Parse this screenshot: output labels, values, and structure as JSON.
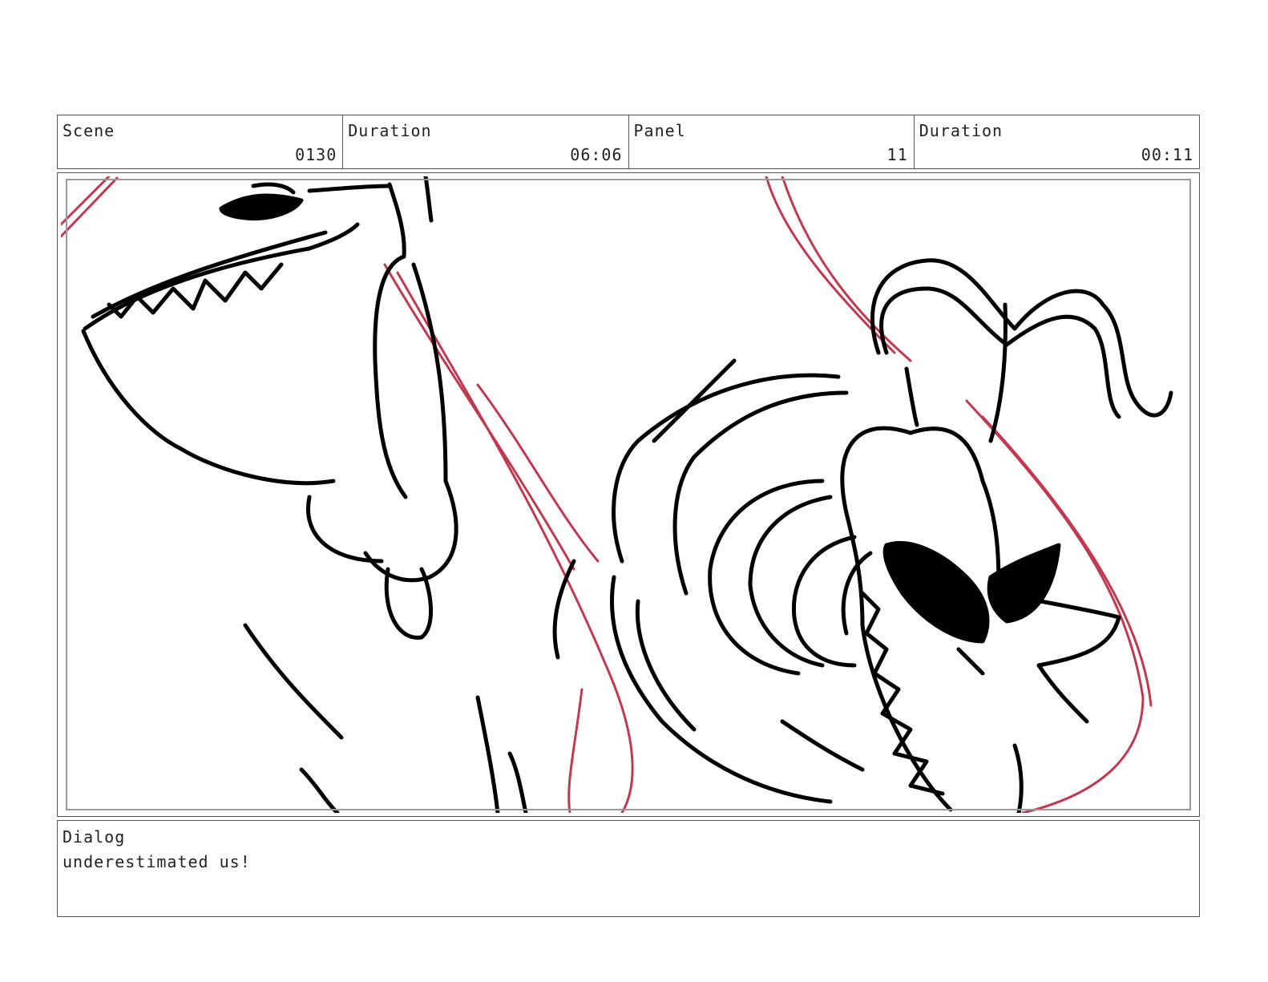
{
  "header": {
    "scene": {
      "label": "Scene",
      "value": "0130"
    },
    "scene_duration": {
      "label": "Duration",
      "value": "06:06"
    },
    "panel": {
      "label": "Panel",
      "value": "11"
    },
    "panel_duration": {
      "label": "Duration",
      "value": "00:11"
    }
  },
  "dialog": {
    "label": "Dialog",
    "text": "underestimated us!"
  },
  "colors": {
    "ink": "#000000",
    "guide_lines": "#c0394f",
    "frame_border": "#555555"
  }
}
